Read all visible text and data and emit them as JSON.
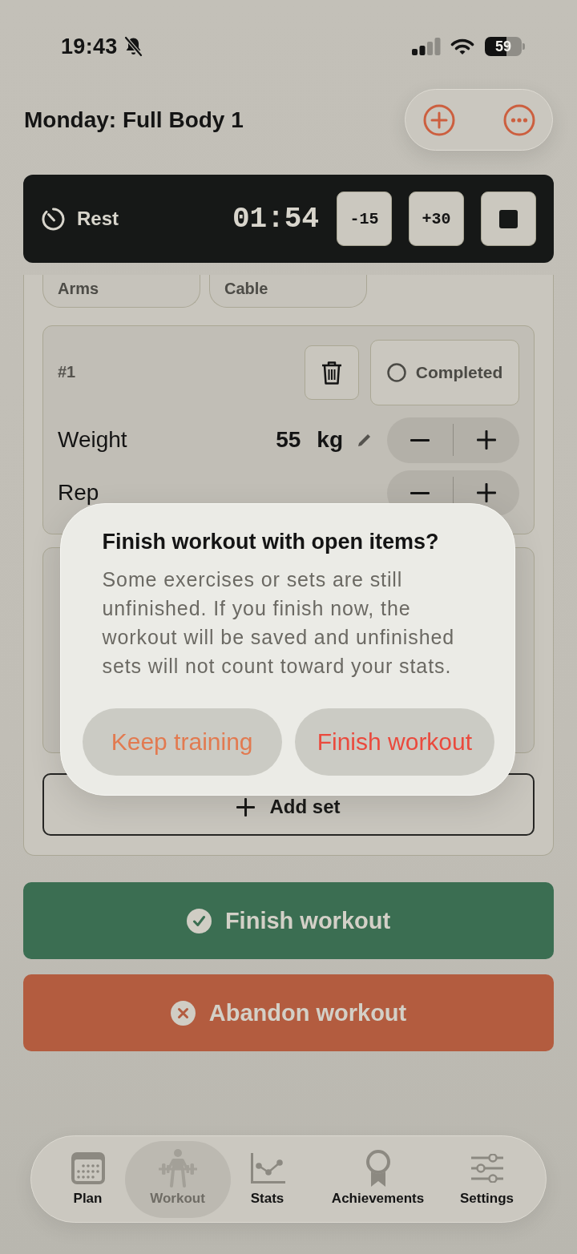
{
  "status_bar": {
    "time": "19:43",
    "battery": "59"
  },
  "header": {
    "title": "Monday: Full Body 1"
  },
  "rest_timer": {
    "label": "Rest",
    "time": "01:54",
    "adjust_buttons": [
      "-15",
      "+30"
    ]
  },
  "exercise": {
    "tags": [
      "Arms",
      "Cable"
    ],
    "sets": [
      {
        "number": "#1",
        "completed": false,
        "completed_label": "Completed",
        "fields": [
          {
            "label": "Weight",
            "value": "55",
            "unit": "kg"
          },
          {
            "label": "Rep"
          }
        ]
      }
    ],
    "add_set_label": "Add set"
  },
  "dialog": {
    "title": "Finish workout with open items?",
    "message": "Some exercises or sets are still unfinished. If you finish now, the workout will be saved and unfinished sets will not count toward your stats.",
    "buttons": [
      {
        "label": "Keep training",
        "kind": "cancel"
      },
      {
        "label": "Finish workout",
        "kind": "destructive"
      }
    ]
  },
  "actions": [
    {
      "label": "Finish workout",
      "kind": "finish"
    },
    {
      "label": "Abandon workout",
      "kind": "abandon"
    }
  ],
  "tab_bar": [
    {
      "label": "Plan",
      "selected": false
    },
    {
      "label": "Workout",
      "selected": true
    },
    {
      "label": "Stats",
      "selected": false
    },
    {
      "label": "Achievements",
      "selected": false
    },
    {
      "label": "Settings",
      "selected": false
    }
  ]
}
